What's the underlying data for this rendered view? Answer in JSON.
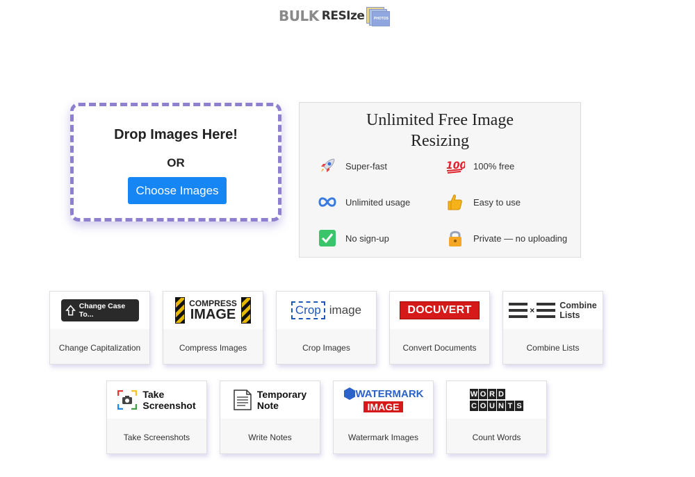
{
  "logo": {
    "word1": "BULK",
    "word2": "RESIze",
    "photos_label": "PHOTOS",
    "alt": "Bulk Resize Photos"
  },
  "drop_zone": {
    "title": "Drop Images Here!",
    "or": "OR",
    "button_label": "Choose Images"
  },
  "features": {
    "title": "Unlimited Free Image Resizing",
    "items": [
      {
        "icon": "rocket-icon",
        "label": "Super-fast"
      },
      {
        "icon": "hundred-icon",
        "label": "100% free"
      },
      {
        "icon": "infinity-icon",
        "label": "Unlimited usage"
      },
      {
        "icon": "thumbs-up-icon",
        "label": "Easy to use"
      },
      {
        "icon": "check-mark-icon",
        "label": "No sign-up"
      },
      {
        "icon": "lock-icon",
        "label": "Private — no uploading"
      }
    ]
  },
  "tools": [
    {
      "graphic": "Change Case To...",
      "caption": "Change Capitalization"
    },
    {
      "graphic_line1": "COMPRESS",
      "graphic_line2": "IMAGE",
      "caption": "Compress Images"
    },
    {
      "graphic_box": "Crop",
      "graphic_rest": "image",
      "caption": "Crop Images"
    },
    {
      "graphic": "DOCUVERT",
      "caption": "Convert Documents"
    },
    {
      "graphic_line1": "Combine",
      "graphic_line2": "Lists",
      "caption": "Combine Lists"
    },
    {
      "graphic_line1": "Take",
      "graphic_line2": "Screenshot",
      "caption": "Take Screenshots"
    },
    {
      "graphic_line1": "Temporary",
      "graphic_line2": "Note",
      "caption": "Write Notes"
    },
    {
      "graphic_line1": "WATERMARK",
      "graphic_line2": "IMAGE",
      "caption": "Watermark Images"
    },
    {
      "graphic_line1": "WORD",
      "graphic_line2": "COUNTS",
      "caption": "Count Words"
    }
  ],
  "colors": {
    "accent_blue": "#1686f5",
    "dashed_border": "#8f7fcf",
    "docuvert_red": "#d61a1a",
    "crop_blue": "#1e57b8"
  }
}
